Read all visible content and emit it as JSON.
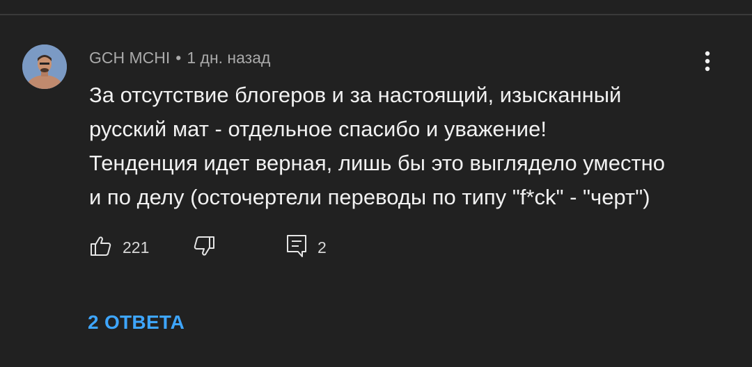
{
  "comment": {
    "author": "GCH MCHI",
    "separator": "•",
    "time": "1 дн. назад",
    "text_lines": [
      "За отсутствие блогеров и за настоящий, изысканный",
      "русский мат - отдельное спасибо и уважение!",
      "Тенденция идет верная, лишь бы это выглядело уместно",
      "и по делу (осточертели переводы по типу \"f*ck\" - \"черт\")"
    ],
    "likes": "221",
    "replies_count": "2",
    "replies_link": "2 ОТВЕТА"
  },
  "icons": {
    "avatar": "avatar",
    "more": "more-vert-icon",
    "like": "thumb-up-icon",
    "dislike": "thumb-down-icon",
    "reply": "comment-icon"
  },
  "colors": {
    "background": "#212121",
    "text": "#f1f1f1",
    "meta": "#aaaaaa",
    "link": "#3ea6ff"
  }
}
